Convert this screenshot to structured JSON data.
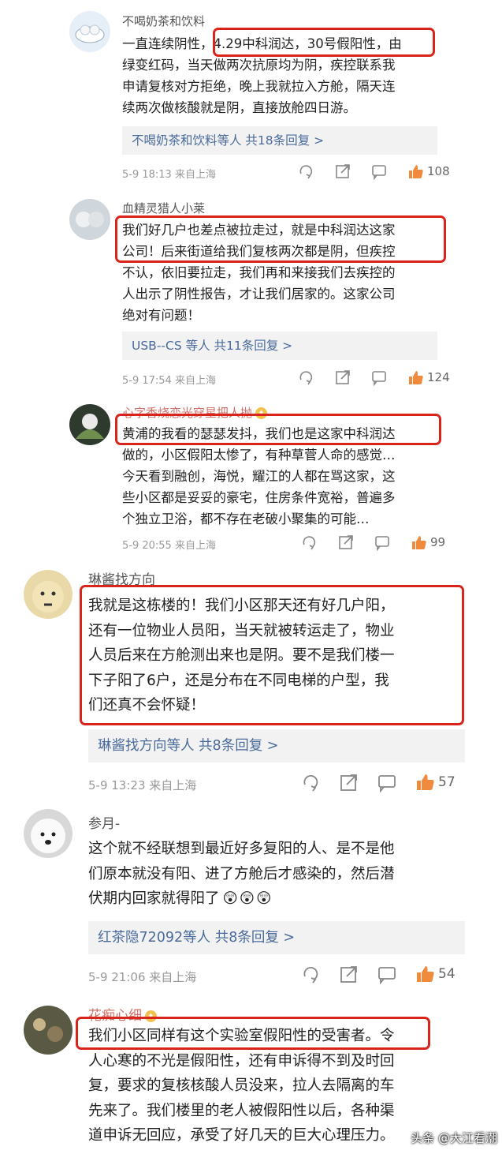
{
  "comments": [
    {
      "username": "不喝奶茶和饮料",
      "lines": [
        "一直连续阴性，4.29中科润达，30号假阳性，由",
        "绿变红码，当天做两次抗原均为阴，疾控联系我",
        "申请复核对方拒绝，晚上我就拉入方舱，隔天连",
        "续两次做核酸就是阴，直接放舱四日游。"
      ],
      "reply_summary": "不喝奶茶和饮料等人 共18条回复 >",
      "meta": "5-9 18:13 来自上海",
      "likes": "108"
    },
    {
      "username": "血精灵猎人小莱",
      "lines": [
        "我们好几户也差点被拉走过，就是中科润达这家",
        "公司！后来街道给我们复核两次都是阴，但疾控",
        "不认，依旧要拉走，我们再和来接我们去疾控的",
        "人出示了阴性报告，才让我们居家的。这家公司",
        "绝对有问题！"
      ],
      "reply_summary": "USB--CS 等人 共11条回复 >",
      "meta": "5-9 17:54 来自上海",
      "likes": "124"
    },
    {
      "username": "心字香烧恋光穿星把人抛",
      "lines": [
        "黄浦的我看的瑟瑟发抖，我们也是这家中科润达",
        "做的，小区假阳太惨了，有种草菅人命的感觉…",
        "今天看到融创，海悦，耀江的人都在骂这家，这",
        "些小区都是妥妥的豪宅，住房条件宽裕，普遍多",
        "个独立卫浴，都不存在老破小聚集的可能…"
      ],
      "meta": "5-9 20:55 来自上海",
      "likes": "99"
    },
    {
      "username": "琳酱找方向",
      "lines": [
        "我就是这栋楼的！我们小区那天还有好几户阳，",
        "还有一位物业人员阳，当天就被转运走了，物业",
        "人员后来在方舱测出来也是阴。要不是我们楼一",
        "下子阳了6户，还是分布在不同电梯的户型，我",
        "们还真不会怀疑！"
      ],
      "reply_summary": "琳酱找方向等人 共8条回复 >",
      "meta": "5-9 13:23 来自上海",
      "likes": "57"
    },
    {
      "username": "参月-",
      "lines": [
        "这个就不经联想到最近好多复阳的人、是不是他",
        "们原本就没有阳、进了方舱后才感染的，然后潜",
        "伏期内回家就得阳了"
      ],
      "emoji": "😲😲😲",
      "reply_summary": "红茶隐72092等人 共8条回复 >",
      "meta": "5-9 21:06 来自上海",
      "likes": "54"
    },
    {
      "username": "花痴心细",
      "lines": [
        "我们小区同样有这个实验室假阳性的受害者。令",
        "人心寒的不光是假阳性，还有申诉得不到及时回",
        "复，要求的复核核酸人员没来，拉人去隔离的车",
        "先来了。我们楼里的老人被假阳性以后，各种渠",
        "道申诉无回应，承受了好几天的巨大心理压力。"
      ]
    }
  ],
  "watermark": "头条 @大江看潮",
  "colors": {
    "highlight": "#d9241b",
    "reply_link": "#4a6a9c",
    "like": "#f08a3c"
  }
}
